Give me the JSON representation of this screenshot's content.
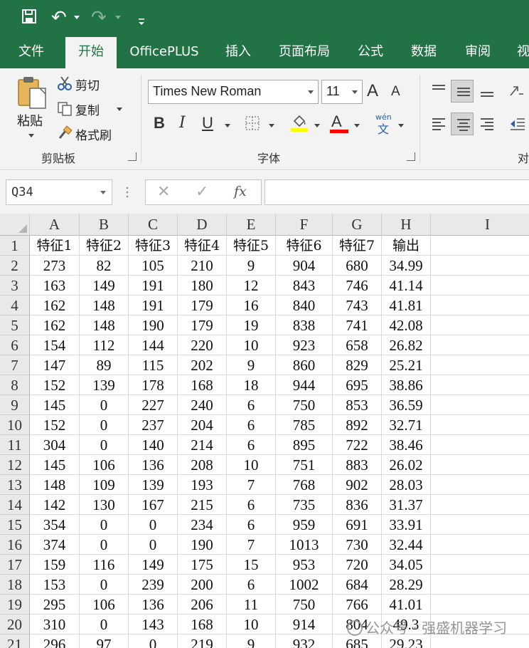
{
  "quick_access": {
    "undo": "↶",
    "redo": "↷"
  },
  "tabs": [
    "文件",
    "开始",
    "OfficePLUS",
    "插入",
    "页面布局",
    "公式",
    "数据",
    "审阅",
    "视"
  ],
  "active_tab": "开始",
  "clipboard": {
    "paste_label": "粘贴",
    "cut_label": "剪切",
    "copy_label": "复制",
    "format_painter_label": "格式刷",
    "group_label": "剪贴板"
  },
  "font": {
    "name": "Times New Roman",
    "size": "11",
    "group_label": "字体",
    "bold": "B",
    "italic": "I",
    "underline": "U",
    "font_color_label": "A",
    "phonetic_top": "wén",
    "phonetic_bottom": "文",
    "grow": "A",
    "shrink": "A"
  },
  "alignment": {
    "group_label_partial": "对"
  },
  "colors": {
    "accent": "#217346",
    "highlight": "#ffff00",
    "font_color": "#ff0000"
  },
  "formula_bar": {
    "name_box": "Q34",
    "cancel": "✕",
    "enter": "✓",
    "fx": "fx",
    "formula": ""
  },
  "sheet": {
    "columns": [
      "A",
      "B",
      "C",
      "D",
      "E",
      "F",
      "G",
      "H",
      "I"
    ],
    "rows": [
      [
        "特征1",
        "特征2",
        "特征3",
        "特征4",
        "特征5",
        "特征6",
        "特征7",
        "输出"
      ],
      [
        "273",
        "82",
        "105",
        "210",
        "9",
        "904",
        "680",
        "34.99"
      ],
      [
        "163",
        "149",
        "191",
        "180",
        "12",
        "843",
        "746",
        "41.14"
      ],
      [
        "162",
        "148",
        "191",
        "179",
        "16",
        "840",
        "743",
        "41.81"
      ],
      [
        "162",
        "148",
        "190",
        "179",
        "19",
        "838",
        "741",
        "42.08"
      ],
      [
        "154",
        "112",
        "144",
        "220",
        "10",
        "923",
        "658",
        "26.82"
      ],
      [
        "147",
        "89",
        "115",
        "202",
        "9",
        "860",
        "829",
        "25.21"
      ],
      [
        "152",
        "139",
        "178",
        "168",
        "18",
        "944",
        "695",
        "38.86"
      ],
      [
        "145",
        "0",
        "227",
        "240",
        "6",
        "750",
        "853",
        "36.59"
      ],
      [
        "152",
        "0",
        "237",
        "204",
        "6",
        "785",
        "892",
        "32.71"
      ],
      [
        "304",
        "0",
        "140",
        "214",
        "6",
        "895",
        "722",
        "38.46"
      ],
      [
        "145",
        "106",
        "136",
        "208",
        "10",
        "751",
        "883",
        "26.02"
      ],
      [
        "148",
        "109",
        "139",
        "193",
        "7",
        "768",
        "902",
        "28.03"
      ],
      [
        "142",
        "130",
        "167",
        "215",
        "6",
        "735",
        "836",
        "31.37"
      ],
      [
        "354",
        "0",
        "0",
        "234",
        "6",
        "959",
        "691",
        "33.91"
      ],
      [
        "374",
        "0",
        "0",
        "190",
        "7",
        "1013",
        "730",
        "32.44"
      ],
      [
        "159",
        "116",
        "149",
        "175",
        "15",
        "953",
        "720",
        "34.05"
      ],
      [
        "153",
        "0",
        "239",
        "200",
        "6",
        "1002",
        "684",
        "28.29"
      ],
      [
        "295",
        "106",
        "136",
        "206",
        "11",
        "750",
        "766",
        "41.01"
      ],
      [
        "310",
        "0",
        "143",
        "168",
        "10",
        "914",
        "804",
        "49.3"
      ],
      [
        "296",
        "97",
        "0",
        "219",
        "9",
        "932",
        "685",
        "29.23"
      ]
    ]
  },
  "watermark": "公众号 · 强盛机器学习"
}
